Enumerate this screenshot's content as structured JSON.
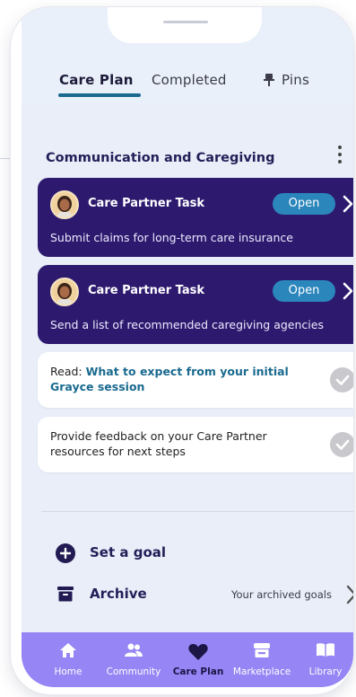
{
  "tabs": [
    {
      "label": "Care Plan",
      "active": true
    },
    {
      "label": "Completed",
      "active": false
    },
    {
      "label": "Pins",
      "active": false
    }
  ],
  "section": {
    "title": "Communication and Caregiving"
  },
  "tasks": [
    {
      "title": "Care Partner Task",
      "status": "Open",
      "description": "Submit claims for long-term care insurance"
    },
    {
      "title": "Care Partner Task",
      "status": "Open",
      "description": "Send a list of recommended caregiving agencies"
    }
  ],
  "items": [
    {
      "prefix": "Read: ",
      "link": "What to expect from your initial Grayce session"
    },
    {
      "text": "Provide feedback on your Care Partner resources for next steps"
    }
  ],
  "actions": {
    "set_goal": "Set a goal",
    "archive": "Archive",
    "archive_sub": "Your archived goals"
  },
  "nav": [
    {
      "label": "Home",
      "icon": "home-icon"
    },
    {
      "label": "Community",
      "icon": "people-icon"
    },
    {
      "label": "Care Plan",
      "icon": "heart-icon",
      "active": true
    },
    {
      "label": "Marketplace",
      "icon": "store-icon"
    },
    {
      "label": "Library",
      "icon": "book-icon"
    }
  ],
  "colors": {
    "task_card": "#2d1a6e",
    "open_pill": "#2b86bc",
    "nav_bar": "#9585f5",
    "accent_link": "#1a6a8f",
    "screen_bg": "#e9eef9"
  }
}
